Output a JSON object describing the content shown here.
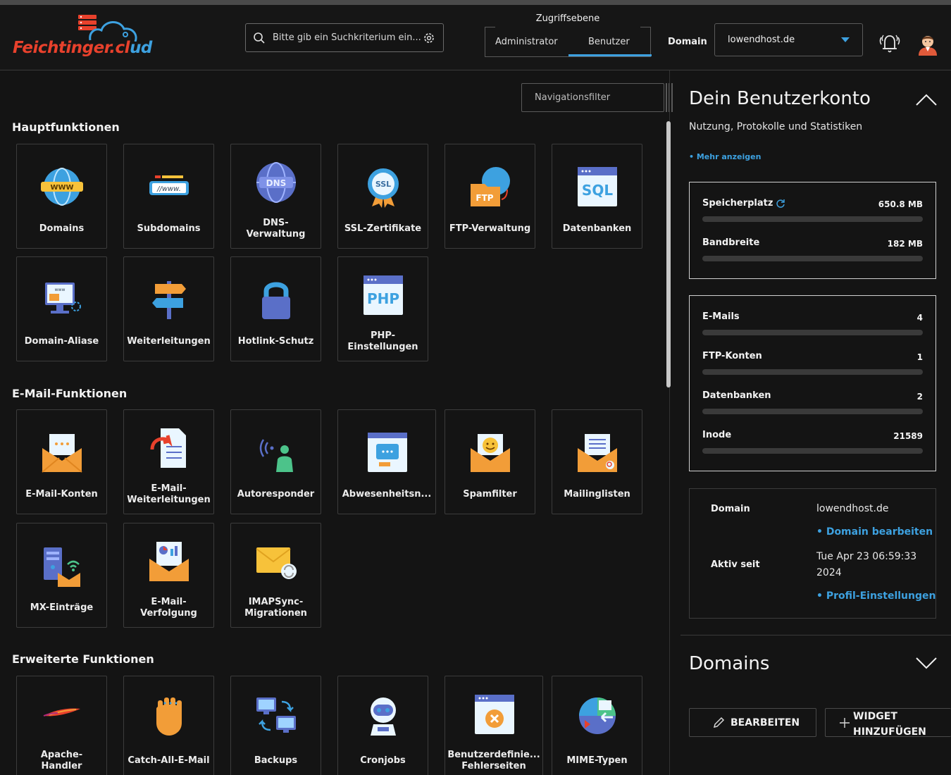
{
  "brand": {
    "name_part1": "Feichtinger.cl",
    "name_part2": "ud"
  },
  "search": {
    "placeholder": "Bitte gib ein Suchkriterium ein..."
  },
  "access": {
    "label": "Zugriffsebene",
    "options": [
      "Administrator",
      "Benutzer"
    ],
    "selected": "Benutzer"
  },
  "domain_select": {
    "label": "Domain",
    "value": "lowendhost.de"
  },
  "nav_filter": {
    "placeholder": "Navigationsfilter"
  },
  "sections": {
    "main": {
      "title": "Hauptfunktionen",
      "items": [
        "Domains",
        "Subdomains",
        "DNS-\nVerwaltung",
        "SSL-Zertifikate",
        "FTP-Verwaltung",
        "Datenbanken",
        "Domain-Aliase",
        "Weiterleitungen",
        "Hotlink-Schutz",
        "PHP-\nEinstellungen"
      ]
    },
    "mail": {
      "title": "E-Mail-Funktionen",
      "items": [
        "E-Mail-Konten",
        "E-Mail-\nWeiterleitungen",
        "Autoresponder",
        "Abwesenheitsn...",
        "Spamfilter",
        "Mailinglisten",
        "MX-Einträge",
        "E-Mail-\nVerfolgung",
        "IMAPSync-\nMigrationen"
      ]
    },
    "advanced": {
      "title": "Erweiterte Funktionen",
      "items": [
        "Apache-\nHandler",
        "Catch-All-E-Mail",
        "Backups",
        "Cronjobs",
        "Benutzerdefinie...\nFehlerseiten",
        "MIME-Typen"
      ]
    }
  },
  "icon_names": {
    "main": [
      "www-globe-icon",
      "subdomain-bar-icon",
      "dns-globe-icon",
      "ssl-badge-icon",
      "ftp-folder-icon",
      "sql-window-icon",
      "domain-alias-monitor-icon",
      "signpost-icon",
      "padlock-icon",
      "php-window-icon"
    ],
    "mail": [
      "mail-account-envelope-icon",
      "mail-forward-document-icon",
      "autoresponder-person-icon",
      "out-of-office-window-icon",
      "spamfilter-envelope-icon",
      "mailinglist-envelope-icon",
      "mx-server-icon",
      "mail-tracking-envelope-icon",
      "imapsync-envelope-icon"
    ],
    "advanced": [
      "apache-feather-icon",
      "catch-all-hand-icon",
      "backups-computers-icon",
      "cronjobs-robot-icon",
      "error-page-window-icon",
      "mime-types-icon"
    ]
  },
  "account_panel": {
    "title": "Dein Benutzerkonto",
    "subtitle": "Nutzung, Protokolle und Statistiken",
    "more_link": "• Mehr anzeigen",
    "usage": [
      {
        "name": "Speicherplatz",
        "value": "650.8 MB",
        "fill_fraction": 0.0
      },
      {
        "name": "Bandbreite",
        "value": "182 MB",
        "fill_fraction": 0.0
      }
    ],
    "counts": [
      {
        "name": "E-Mails",
        "value": "4",
        "fill_fraction": 0.0
      },
      {
        "name": "FTP-Konten",
        "value": "1",
        "fill_fraction": 0.0
      },
      {
        "name": "Datenbanken",
        "value": "2",
        "fill_fraction": 0.0
      },
      {
        "name": "Inode",
        "value": "21589",
        "fill_fraction": 0.0
      }
    ],
    "info": {
      "domain_label": "Domain",
      "domain_value": "lowendhost.de",
      "edit_domain_link": "• Domain bearbeiten",
      "active_label": "Aktiv seit",
      "active_line1": "Tue Apr 23 06:59:33",
      "active_line2": "2024",
      "profile_link": "• Profil-Einstellungen"
    }
  },
  "domains_panel": {
    "title": "Domains",
    "edit_button": "BEARBEITEN",
    "add_widget_line1": "WIDGET",
    "add_widget_line2": "HINZUFÜGEN"
  },
  "colors": {
    "accent": "#3da1e0",
    "brand_red": "#e8412c",
    "background": "#141414"
  }
}
